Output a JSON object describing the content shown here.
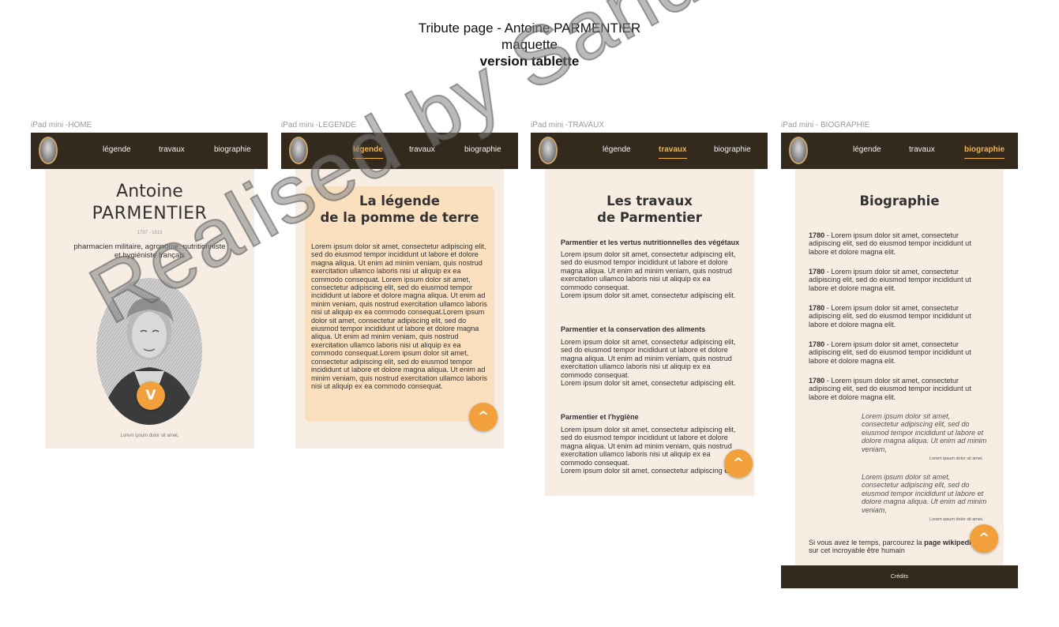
{
  "header": {
    "line1": "Tribute page - Antoine PARMENTIER",
    "line2": "maquette",
    "line3": "version tablette"
  },
  "nav_items": {
    "legende": "légende",
    "travaux": "travaux",
    "biographie": "biographie"
  },
  "frames": {
    "home": {
      "label": "iPad mini -HOME",
      "title_line1": "Antoine",
      "title_line2": "PARMENTIER",
      "dates": "1737 - 1813",
      "subtitle": "pharmacien militaire, agronome, nutritionniste\net hygiéniste français",
      "caption": "Lorem ipsum dolor sit amet,",
      "fab_icon": "chevron-down-icon",
      "fab_glyph": "V"
    },
    "legende": {
      "label": "iPad mini -LEGENDE",
      "title": "La légende\nde la pomme de terre",
      "body": "Lorem ipsum dolor sit amet, consectetur adipiscing elit, sed do eiusmod tempor incididunt ut labore et dolore magna aliqua. Ut enim ad minim veniam, quis nostrud exercitation ullamco laboris nisi ut aliquip ex ea commodo consequat. Lorem ipsum dolor sit amet, consectetur adipiscing elit, sed do eiusmod tempor incididunt ut labore et dolore magna aliqua. Ut enim ad minim veniam, quis nostrud exercitation ullamco laboris nisi ut aliquip ex ea commodo consequat.Lorem ipsum dolor sit amet, consectetur adipiscing elit, sed do eiusmod tempor incididunt ut labore et dolore magna aliqua. Ut enim ad minim veniam, quis nostrud exercitation ullamco laboris nisi ut aliquip ex ea commodo consequat.Lorem ipsum dolor sit amet, consectetur adipiscing elit, sed do eiusmod tempor incididunt ut labore et dolore magna aliqua. Ut enim ad minim veniam, quis nostrud exercitation ullamco laboris nisi ut aliquip ex ea commodo consequat.",
      "fab_icon": "chevron-up-icon",
      "fab_glyph": "^"
    },
    "travaux": {
      "label": "iPad mini -TRAVAUX",
      "title": "Les travaux\nde Parmentier",
      "sections": [
        {
          "title": "Parmentier et les vertus nutritionnelles des végétaux",
          "body": "Lorem ipsum dolor sit amet, consectetur adipiscing elit, sed do eiusmod tempor incididunt ut labore et dolore magna aliqua. Ut enim ad minim veniam, quis nostrud exercitation ullamco laboris nisi ut aliquip ex ea commodo consequat.\nLorem ipsum dolor sit amet, consectetur adipiscing elit."
        },
        {
          "title": "Parmentier et la conservation des aliments",
          "body": "Lorem ipsum dolor sit amet, consectetur adipiscing elit, sed do eiusmod tempor incididunt ut labore et dolore magna aliqua. Ut enim ad minim veniam, quis nostrud exercitation ullamco laboris nisi ut aliquip ex ea commodo consequat.\nLorem ipsum dolor sit amet, consectetur adipiscing elit."
        },
        {
          "title": "Parmentier et l'hygiène",
          "body": "Lorem ipsum dolor sit amet, consectetur adipiscing elit, sed do eiusmod tempor incididunt ut labore et dolore magna aliqua. Ut enim ad minim veniam, quis nostrud exercitation ullamco laboris nisi ut aliquip ex ea commodo consequat.\nLorem ipsum dolor sit amet, consectetur adipiscing elit."
        }
      ],
      "fab_icon": "chevron-up-icon",
      "fab_glyph": "^"
    },
    "biographie": {
      "label": "iPad mini - BIOGRAPHIE",
      "title": "Biographie",
      "entries": [
        {
          "year": "1780",
          "text": " - Lorem ipsum dolor sit amet, consectetur adipiscing elit, sed do eiusmod tempor incididunt ut labore et dolore magna  elit."
        },
        {
          "year": "1780",
          "text": " - Lorem ipsum dolor sit amet, consectetur adipiscing elit, sed do eiusmod tempor incididunt ut labore et dolore magna  elit."
        },
        {
          "year": "1780",
          "text": " - Lorem ipsum dolor sit amet, consectetur adipiscing elit, sed do eiusmod tempor incididunt ut labore et dolore magna  elit."
        },
        {
          "year": "1780",
          "text": " - Lorem ipsum dolor sit amet, consectetur adipiscing elit, sed do eiusmod tempor incididunt ut labore et dolore magna  elit."
        },
        {
          "year": "1780",
          "text": " - Lorem ipsum dolor sit amet, consectetur adipiscing elit, sed do eiusmod tempor incididunt ut labore et dolore magna  elit."
        }
      ],
      "quotes": [
        {
          "text": "Lorem ipsum dolor sit amet, consectetur adipiscing elit, sed do eiusmod tempor incididunt ut labore et dolore magna aliqua. Ut enim ad minim veniam,",
          "author": "Lorem ipsum dolor sit amet,"
        },
        {
          "text": "Lorem ipsum dolor sit amet, consectetur adipiscing elit, sed do eiusmod tempor incididunt ut labore et dolore magna aliqua. Ut enim ad minim veniam,",
          "author": "Lorem ipsum dolor sit amet,"
        }
      ],
      "footer_prefix": "Si vous avez le temps, parcourez la ",
      "footer_link": "page wikipedia",
      "footer_suffix": "sur cet incroyable être humain",
      "credits": "Crédits",
      "fab_icon": "chevron-up-icon",
      "fab_glyph": "^"
    }
  },
  "watermark": "Realised by Sandrine MANGUY",
  "colors": {
    "nav_bg": "#33291c",
    "panel_bg": "#f7ede2",
    "card_bg": "#fae0bf",
    "accent": "#f2a03b",
    "active_nav": "#f3b14a"
  }
}
